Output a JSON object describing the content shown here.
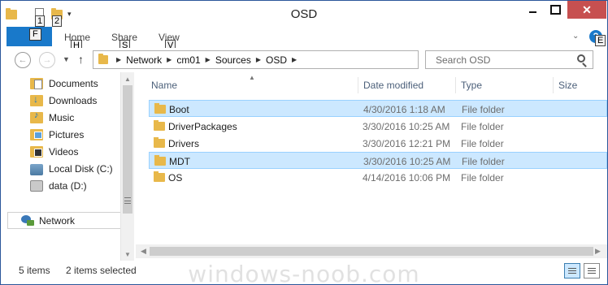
{
  "window": {
    "title": "OSD"
  },
  "quick_access": {
    "keytip_1": "1",
    "keytip_2": "2"
  },
  "ribbon": {
    "file_tab": "F",
    "tabs": [
      {
        "label": "Home",
        "keytip": "H"
      },
      {
        "label": "Share",
        "keytip": "S"
      },
      {
        "label": "View",
        "keytip": "V"
      }
    ],
    "help_label": "?",
    "help_keytip": "E"
  },
  "address": {
    "crumbs": [
      "Network",
      "cm01",
      "Sources",
      "OSD"
    ],
    "search_placeholder": "Search OSD"
  },
  "nav": {
    "items": [
      {
        "label": "Documents",
        "icon": "documents-folder-icon"
      },
      {
        "label": "Downloads",
        "icon": "downloads-folder-icon"
      },
      {
        "label": "Music",
        "icon": "music-folder-icon"
      },
      {
        "label": "Pictures",
        "icon": "pictures-folder-icon"
      },
      {
        "label": "Videos",
        "icon": "videos-folder-icon"
      },
      {
        "label": "Local Disk (C:)",
        "icon": "local-disk-icon"
      },
      {
        "label": "data (D:)",
        "icon": "drive-icon"
      }
    ],
    "network": "Network"
  },
  "columns": {
    "name": "Name",
    "date": "Date modified",
    "type": "Type",
    "size": "Size"
  },
  "files": [
    {
      "name": "Boot",
      "date": "4/30/2016 1:18 AM",
      "type": "File folder",
      "selected": true
    },
    {
      "name": "DriverPackages",
      "date": "3/30/2016 10:25 AM",
      "type": "File folder",
      "selected": false
    },
    {
      "name": "Drivers",
      "date": "3/30/2016 12:21 PM",
      "type": "File folder",
      "selected": false
    },
    {
      "name": "MDT",
      "date": "3/30/2016 10:25 AM",
      "type": "File folder",
      "selected": true
    },
    {
      "name": "OS",
      "date": "4/14/2016 10:06 PM",
      "type": "File folder",
      "selected": false
    }
  ],
  "status": {
    "item_count": "5 items",
    "selected_count": "2 items selected"
  },
  "watermark": "windows-noob.com",
  "colors": {
    "accent": "#1979ca",
    "selection": "#cce8ff",
    "close": "#c75050"
  }
}
